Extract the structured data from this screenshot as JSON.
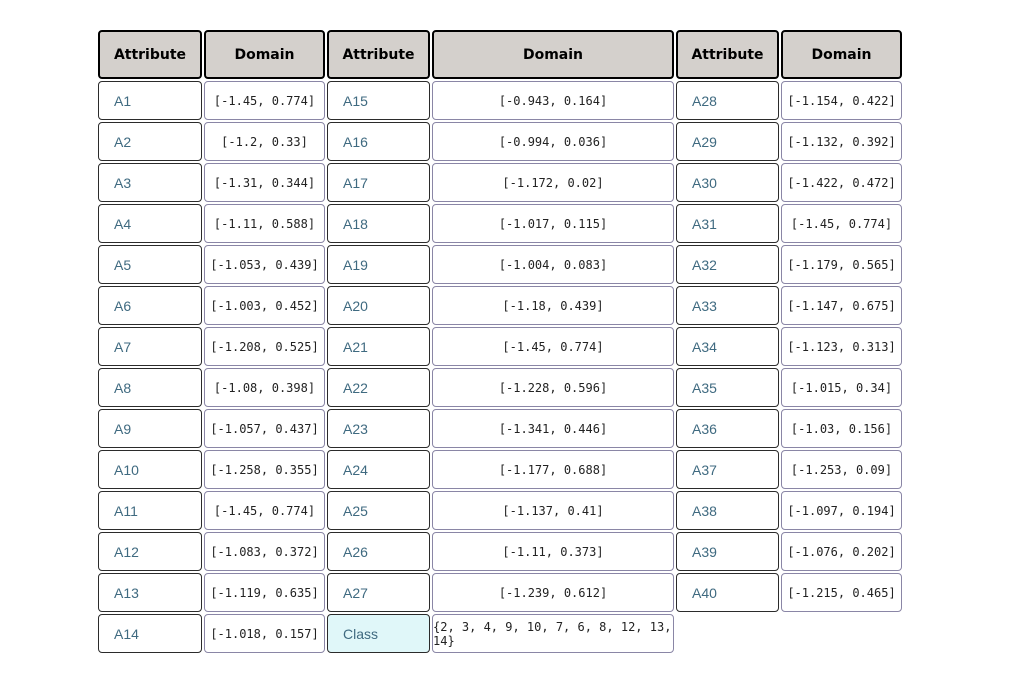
{
  "headers": [
    "Attribute",
    "Domain",
    "Attribute",
    "Domain",
    "Attribute",
    "Domain"
  ],
  "rows": [
    [
      [
        "A1",
        "[-1.45, 0.774]"
      ],
      [
        "A15",
        "[-0.943, 0.164]"
      ],
      [
        "A28",
        "[-1.154, 0.422]"
      ]
    ],
    [
      [
        "A2",
        "[-1.2, 0.33]"
      ],
      [
        "A16",
        "[-0.994, 0.036]"
      ],
      [
        "A29",
        "[-1.132, 0.392]"
      ]
    ],
    [
      [
        "A3",
        "[-1.31, 0.344]"
      ],
      [
        "A17",
        "[-1.172, 0.02]"
      ],
      [
        "A30",
        "[-1.422, 0.472]"
      ]
    ],
    [
      [
        "A4",
        "[-1.11, 0.588]"
      ],
      [
        "A18",
        "[-1.017, 0.115]"
      ],
      [
        "A31",
        "[-1.45, 0.774]"
      ]
    ],
    [
      [
        "A5",
        "[-1.053, 0.439]"
      ],
      [
        "A19",
        "[-1.004, 0.083]"
      ],
      [
        "A32",
        "[-1.179, 0.565]"
      ]
    ],
    [
      [
        "A6",
        "[-1.003, 0.452]"
      ],
      [
        "A20",
        "[-1.18, 0.439]"
      ],
      [
        "A33",
        "[-1.147, 0.675]"
      ]
    ],
    [
      [
        "A7",
        "[-1.208, 0.525]"
      ],
      [
        "A21",
        "[-1.45, 0.774]"
      ],
      [
        "A34",
        "[-1.123, 0.313]"
      ]
    ],
    [
      [
        "A8",
        "[-1.08, 0.398]"
      ],
      [
        "A22",
        "[-1.228, 0.596]"
      ],
      [
        "A35",
        "[-1.015, 0.34]"
      ]
    ],
    [
      [
        "A9",
        "[-1.057, 0.437]"
      ],
      [
        "A23",
        "[-1.341, 0.446]"
      ],
      [
        "A36",
        "[-1.03, 0.156]"
      ]
    ],
    [
      [
        "A10",
        "[-1.258, 0.355]"
      ],
      [
        "A24",
        "[-1.177, 0.688]"
      ],
      [
        "A37",
        "[-1.253, 0.09]"
      ]
    ],
    [
      [
        "A11",
        "[-1.45, 0.774]"
      ],
      [
        "A25",
        "[-1.137, 0.41]"
      ],
      [
        "A38",
        "[-1.097, 0.194]"
      ]
    ],
    [
      [
        "A12",
        "[-1.083, 0.372]"
      ],
      [
        "A26",
        "[-1.11, 0.373]"
      ],
      [
        "A39",
        "[-1.076, 0.202]"
      ]
    ],
    [
      [
        "A13",
        "[-1.119, 0.635]"
      ],
      [
        "A27",
        "[-1.239, 0.612]"
      ],
      [
        "A40",
        "[-1.215, 0.465]"
      ]
    ],
    [
      [
        "A14",
        "[-1.018, 0.157]"
      ],
      [
        "Class",
        "{2, 3, 4, 9, 10, 7, 6, 8, 12, 13, 14}"
      ],
      null
    ]
  ],
  "highlight_cell": "Class",
  "colors": {
    "header_bg": "#d4d0cc",
    "attribute_text": "#3f6a80",
    "class_bg": "#e0f7f9",
    "domain_border": "#8a86a6"
  }
}
